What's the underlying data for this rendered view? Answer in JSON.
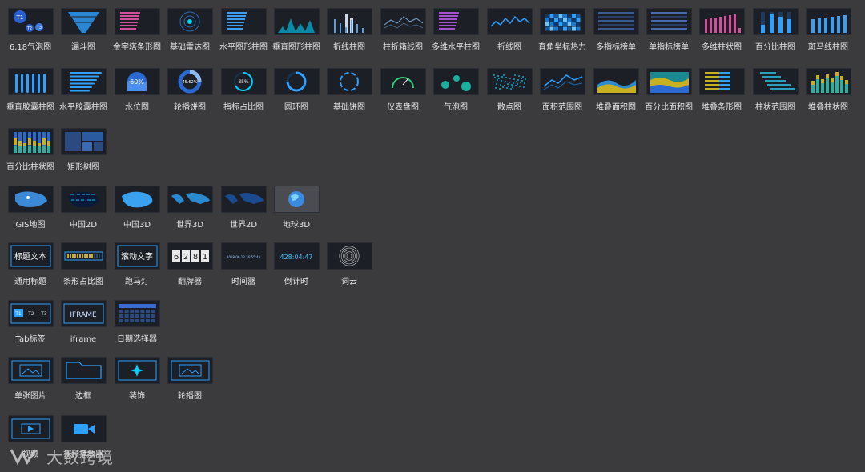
{
  "row1": [
    "6.18气泡图",
    "漏斗图",
    "金字塔条形图",
    "基础雷达图",
    "水平图形柱图",
    "垂直图形柱图",
    "折线柱图",
    "柱折箱线图",
    "多维水平柱图",
    "折线图",
    "直角坐标热力",
    "多指标榜单",
    "单指标榜单",
    "多维柱状图",
    "百分比柱图",
    "斑马线柱图"
  ],
  "row2": [
    "垂直胶囊柱图",
    "水平胶囊柱图",
    "水位图",
    "轮播饼图",
    "指标占比图",
    "圆环图",
    "基础饼图",
    "仪表盘图",
    "气泡图",
    "散点图",
    "面积范围图",
    "堆叠面积图",
    "百分比面积图",
    "堆叠条形图",
    "柱状范围图",
    "堆叠柱状图"
  ],
  "row3": [
    "百分比柱状图",
    "矩形树图"
  ],
  "row4": [
    "GIS地图",
    "中国2D",
    "中国3D",
    "世界3D",
    "世界2D",
    "地球3D"
  ],
  "row5": [
    "通用标题",
    "条形占比图",
    "跑马灯",
    "翻牌器",
    "时间器",
    "倒计时",
    "词云"
  ],
  "row6": [
    "Tab标签",
    "iframe",
    "日期选择器"
  ],
  "row7": [
    "单张图片",
    "边框",
    "装饰",
    "轮播图"
  ],
  "row8": [
    "视频",
    "视频播放器"
  ],
  "thumb_text": {
    "bubble": [
      "T1",
      "T2",
      "T3"
    ],
    "water": "60%",
    "pie_carousel": "45.62%",
    "ratio": "85%",
    "title_text": "标题文本",
    "marquee": "滚动文字",
    "flip": [
      "6",
      "2",
      "8",
      "1"
    ],
    "timer": "2018.06.13 16:55:43",
    "countdown": "428:04:47",
    "tabs": [
      "T1",
      "T2",
      "T3"
    ],
    "iframe": "IFRAME"
  },
  "watermark": "大数跨境",
  "colors": {
    "background": "#3b3b3d",
    "thumb": "#1c1f26",
    "accent": "#2ea0ff",
    "label": "#e6e6e6"
  }
}
